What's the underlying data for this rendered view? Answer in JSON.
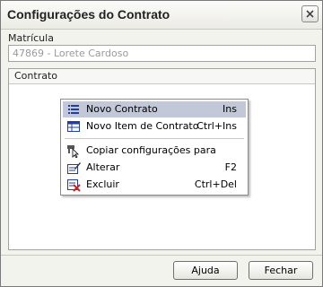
{
  "window": {
    "title": "Configurações do Contrato"
  },
  "form": {
    "matricula_label": "Matrícula",
    "matricula_value": "47869 - Lorete Cardoso",
    "contrato_header": "Contrato"
  },
  "context_menu": {
    "items": [
      {
        "label": "Novo Contrato",
        "shortcut": "Ins",
        "icon": "list-icon",
        "highlighted": true
      },
      {
        "label": "Novo Item de Contrato",
        "shortcut": "Ctrl+Ins",
        "icon": "table-icon"
      },
      {
        "label": "Copiar configurações para",
        "shortcut": "",
        "icon": "copy-config-icon"
      },
      {
        "label": "Alterar",
        "shortcut": "F2",
        "icon": "edit-icon"
      },
      {
        "label": "Excluir",
        "shortcut": "Ctrl+Del",
        "icon": "delete-icon"
      }
    ]
  },
  "buttons": {
    "help": "Ajuda",
    "close": "Fechar"
  },
  "colors": {
    "menu_highlight": "#c2c8d8",
    "icon_blue": "#1f3fa8",
    "delete_red": "#cc2222"
  }
}
